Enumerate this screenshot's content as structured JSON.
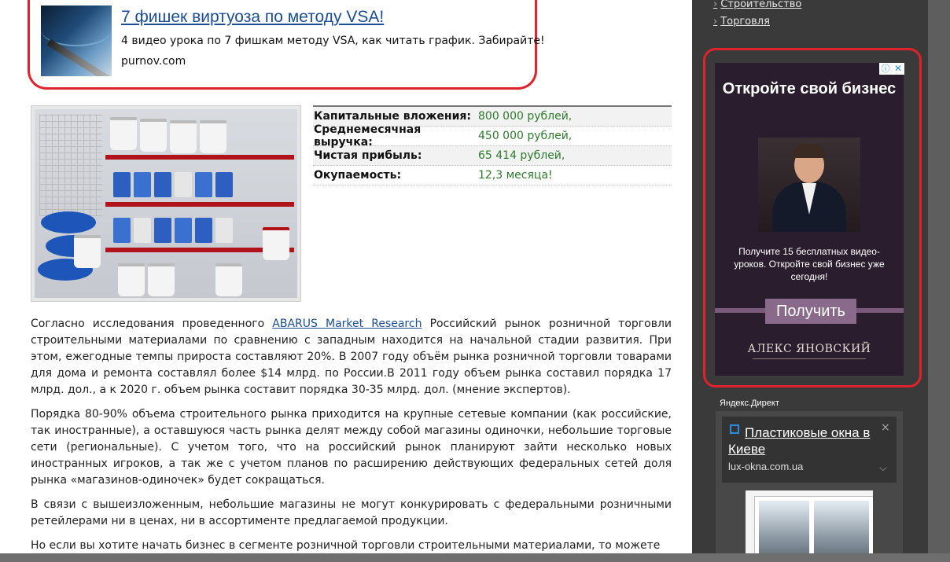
{
  "top_ad": {
    "title": "7 фишек виртуоза по методу VSA!",
    "description": "4 видео урока по 7 фишкам методу VSA, как читать график. Забирайте!",
    "domain": "purnov.com"
  },
  "specs": [
    {
      "label": "Капитальные вложения:",
      "value": "800 000 рублей,"
    },
    {
      "label": "Среднемесячная выручка:",
      "value": "450 000 рублей,"
    },
    {
      "label": "Чистая прибыль:",
      "value": "65 414 рублей,"
    },
    {
      "label": "Окупаемость:",
      "value": "12,3 месяца!"
    }
  ],
  "article": {
    "p1_before_link": "Согласно исследования проведенного ",
    "p1_link": "ABARUS Market Research",
    "p1_after_link": " Российский рынок розничной торговли строительными материалами по сравнению с западным находится на начальной стадии развития. При этом, ежегодные темпы прироста составляют 20%. В 2007 году объём рынка розничной торговли товарами для дома и ремонта составлял более $14 млрд. по России.В 2011 году объем рынка составил порядка 17 млрд. дол., а к 2020 г. объем рынка составит порядка 30-35 млрд. дол. (мнение экспертов).",
    "p2": "Порядка 80-90% объема строительного рынка приходится на крупные сетевые компании (как российские, так иностранные), а оставшуюся часть рынка делят между собой магазины одиночки, небольшие торговые сети (региональные). С учетом того, что на российский рынок планируют зайти несколько новых иностранных игроков, а так же с учетом планов по расширению действующих федеральных сетей доля рынка «магазинов-одиночек» будет сокращаться.",
    "p3": "В связи с вышеизложенным, небольшие магазины не могут конкурировать с федеральными розничными ретейлерами ни в ценах, ни в ассортименте предлагаемой продукции.",
    "p4": "Но если вы хотите начать бизнес в сегменте розничной торговли строительными материалами, то можете"
  },
  "sidebar": {
    "categories": [
      "Строительство",
      "Торговля"
    ],
    "side_ad": {
      "headline": "Откройте свой бизнес",
      "subtext": "Получите 15 бесплатных видео-уроков. Откройте свой бизнес уже сегодня!",
      "button": "Получить",
      "signature": "АЛЕКС ЯНОВСКИЙ",
      "info_icon": "ⓘ",
      "close_icon": "✕"
    },
    "yandex": {
      "label": "Яндекс.Директ",
      "title": "Пластиковые окна в Киеве",
      "domain": "lux-okna.com.ua",
      "close": "×",
      "chevron": "⌵"
    }
  },
  "colors": {
    "ad_border": "#e0222c",
    "link": "#1a4d93",
    "spec_value": "#2c7a2c",
    "sidebar_bg": "#3a3a3a"
  }
}
